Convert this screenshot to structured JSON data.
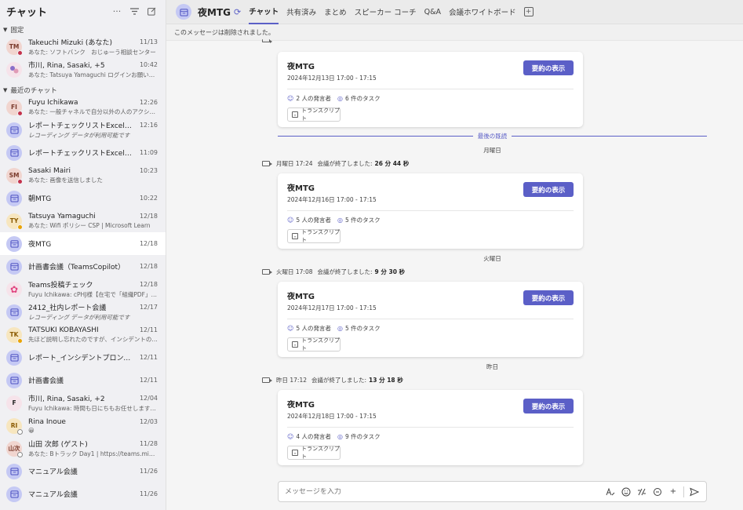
{
  "sidebar": {
    "title": "チャット",
    "sections": {
      "pinned": "固定",
      "recent": "最近のチャット"
    },
    "pinned": [
      {
        "initials": "TM",
        "name": "Takeuchi Mizuki (あなた)",
        "time": "11/13",
        "preview": "あなた: ソフトバンク　おじゅーう相談センター"
      },
      {
        "initials": "",
        "name": "市川, Rina, Sasaki, +5",
        "time": "10:42",
        "preview": "あなた: Tatsuya Yamaguchi ログインお願いします！y..."
      }
    ],
    "recent": [
      {
        "initials": "FI",
        "name": "Fuyu Ichikawa",
        "time": "12:26",
        "preview": "あなた: 一般チャネルで自分以外の人のアクションで続..."
      },
      {
        "initials": "",
        "name": "レポートチェックリストExcel確認",
        "time": "12:16",
        "preview": "レコーディング データが利用可能です"
      },
      {
        "initials": "",
        "name": "レポートチェックリストExcel確認",
        "time": "11:09",
        "preview": ""
      },
      {
        "initials": "SM",
        "name": "Sasaki Mairi",
        "time": "10:23",
        "preview": "あなた: 画像を送信しました"
      },
      {
        "initials": "",
        "name": "朝MTG",
        "time": "10:22",
        "preview": ""
      },
      {
        "initials": "TY",
        "name": "Tatsuya Yamaguchi",
        "time": "12/18",
        "preview": "あなた: Wifi ポリシー CSP | Microsoft Learn"
      },
      {
        "initials": "",
        "name": "夜MTG",
        "time": "12/18",
        "preview": ""
      },
      {
        "initials": "",
        "name": "計画書会議（TeamsCopilot）",
        "time": "12/18",
        "preview": ""
      },
      {
        "initials": "",
        "name": "Teams投稿チェック",
        "time": "12/18",
        "preview": "Fuyu Ichikawa: cPHJ様【在宅で「組織PDF」が開け..."
      },
      {
        "initials": "",
        "name": "2412_社内レポート会議",
        "time": "12/17",
        "preview": "レコーディング データが利用可能です"
      },
      {
        "initials": "TK",
        "name": "TATSUKI KOBAYASHI",
        "time": "12/11",
        "preview": "先ほど説明し忘れたのですが、インシデントのスライド..."
      },
      {
        "initials": "",
        "name": "レポート_インシデントプロンプトについて",
        "time": "12/11",
        "preview": ""
      },
      {
        "initials": "",
        "name": "計画書会議",
        "time": "12/11",
        "preview": ""
      },
      {
        "initials": "F",
        "name": "市川, Rina, Sasaki, +2",
        "time": "12/04",
        "preview": "Fuyu Ichikawa: 時間も日にちもお任せします！😍"
      },
      {
        "initials": "RI",
        "name": "Rina Inoue",
        "time": "12/03",
        "preview": "😀"
      },
      {
        "initials": "山次",
        "name": "山田 次郎 (ゲスト)",
        "time": "11/28",
        "preview": "あなた: Bトラック Day1 | https://teams.microsoft.c..."
      },
      {
        "initials": "",
        "name": "マニュアル会議",
        "time": "11/26",
        "preview": ""
      },
      {
        "initials": "",
        "name": "マニュアル会議",
        "time": "11/26",
        "preview": ""
      }
    ]
  },
  "header": {
    "title": "夜MTG",
    "tabs": [
      "チャット",
      "共有済み",
      "まとめ",
      "スピーカー コーチ",
      "Q&A",
      "会議ホワイトボード"
    ]
  },
  "banner": "このメッセージは削除されました。",
  "last_read": "最後の既読",
  "cards": [
    {
      "title": "夜MTG",
      "date": "2024年12月13日 17:00 - 17:15",
      "speakers": "2 人の発言者",
      "tasks": "6 件のタスク",
      "button": "要約の表示",
      "transcript": "トランスクリプト"
    },
    {
      "title": "夜MTG",
      "date": "2024年12月16日 17:00 - 17:15",
      "speakers": "5 人の発言者",
      "tasks": "5 件のタスク",
      "button": "要約の表示",
      "transcript": "トランスクリプト"
    },
    {
      "title": "夜MTG",
      "date": "2024年12月17日 17:00 - 17:15",
      "speakers": "5 人の発言者",
      "tasks": "5 件のタスク",
      "button": "要約の表示",
      "transcript": "トランスクリプト"
    },
    {
      "title": "夜MTG",
      "date": "2024年12月18日 17:00 - 17:15",
      "speakers": "4 人の発言者",
      "tasks": "9 件のタスク",
      "button": "要約の表示",
      "transcript": "トランスクリプト"
    }
  ],
  "days": [
    "月曜日",
    "火曜日",
    "昨日"
  ],
  "events": [
    {
      "time": "月曜日 17:24",
      "text": "会議が終了しました:",
      "duration": "26 分 44 秒"
    },
    {
      "time": "火曜日 17:08",
      "text": "会議が終了しました:",
      "duration": "9 分 30 秒"
    },
    {
      "time": "昨日 17:12",
      "text": "会議が終了しました:",
      "duration": "13 分 18 秒"
    }
  ],
  "compose": {
    "placeholder": "メッセージを入力"
  },
  "colors": {
    "accent": "#5b5fc7"
  }
}
